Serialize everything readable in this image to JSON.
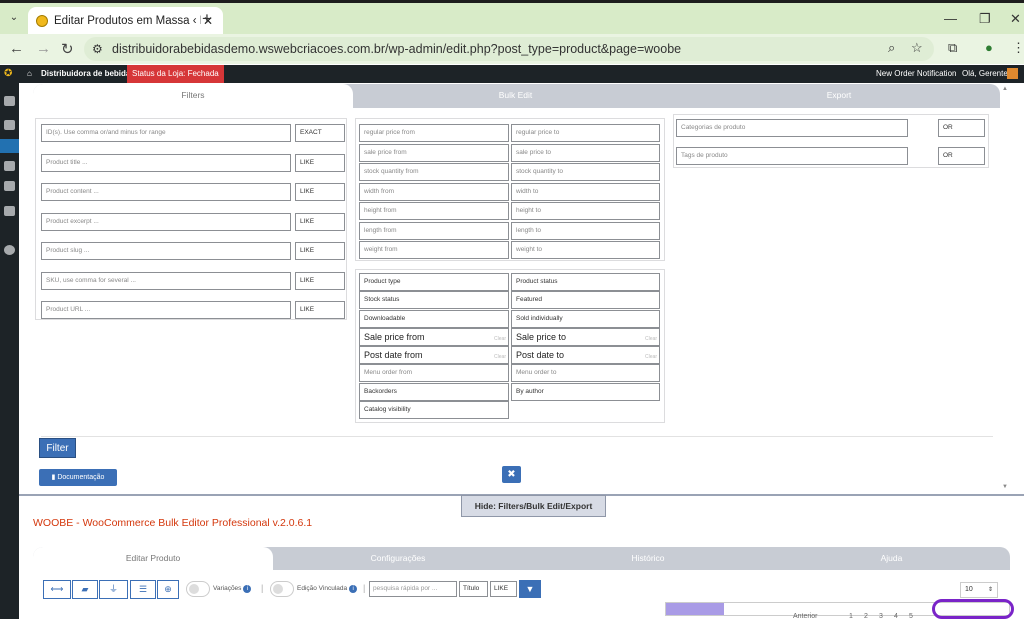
{
  "browser": {
    "tab_title": "Editar Produtos em Massa ‹ Dis",
    "url": "distribuidorabebidasdemo.wswebcriacoes.com.br/wp-admin/edit.php?post_type=product&page=woobe"
  },
  "wpbar": {
    "site": "Distribuidora de bebidas",
    "store_status": "Status da Loja: Fechada",
    "notification": "New Order Notification",
    "greeting": "Olá, Gerente"
  },
  "panel_tabs": [
    "Filters",
    "Bulk Edit",
    "Export"
  ],
  "filters": {
    "col1": [
      {
        "ph": "ID(s). Use comma or/and minus for range",
        "op": "EXACT"
      },
      {
        "ph": "Product title ...",
        "op": "LIKE"
      },
      {
        "ph": "Product content ...",
        "op": "LIKE"
      },
      {
        "ph": "Product excerpt ...",
        "op": "LIKE"
      },
      {
        "ph": "Product slug ...",
        "op": "LIKE"
      },
      {
        "ph": "SKU, use comma for several ...",
        "op": "LIKE"
      },
      {
        "ph": "Product URL ...",
        "op": "LIKE"
      }
    ],
    "ranges": [
      [
        "regular price from",
        "regular price to"
      ],
      [
        "sale price from",
        "sale price to"
      ],
      [
        "stock quantity from",
        "stock quantity to"
      ],
      [
        "width from",
        "width to"
      ],
      [
        "height from",
        "height to"
      ],
      [
        "length from",
        "length to"
      ],
      [
        "weight from",
        "weight to"
      ]
    ],
    "selects": [
      [
        "Product type",
        "Product status"
      ],
      [
        "Stock status",
        "Featured"
      ],
      [
        "Downloadable",
        "Sold individually"
      ]
    ],
    "dates": [
      [
        "Sale price from",
        "Sale price to"
      ],
      [
        "Post date from",
        "Post date to"
      ]
    ],
    "date_clear": "Clear",
    "menu_order": [
      "Menu order from",
      "Menu order to"
    ],
    "misc": [
      [
        "Backorders",
        "By author"
      ]
    ],
    "catalog": "Catalog visibility",
    "tax": [
      {
        "ph": "Categorias de produto",
        "op": "OR"
      },
      {
        "ph": "Tags de produto",
        "op": "OR"
      }
    ],
    "filter_btn": "Filter",
    "doc_btn": "Documentação",
    "close_btn": "✖"
  },
  "hide_btn": "Hide: Filters/Bulk Edit/Export",
  "app_title": "WOOBE - WooCommerce Bulk Editor Professional v.2.0.6.1",
  "bottom_tabs": [
    "Editar Produto",
    "Configurações",
    "Histórico",
    "Ajuda"
  ],
  "toolbar": {
    "variacoes": "Variações",
    "edicao": "Edição Vinculada",
    "search_ph": "pesquisa rápida por ...",
    "field": "Título",
    "op": "LIKE",
    "per_page": "10",
    "sep": "|"
  },
  "pagination": {
    "prev": "Anterior",
    "pages": [
      "1",
      "2",
      "3",
      "4",
      "5"
    ]
  },
  "progress": 0.17,
  "colors": {
    "accent": "#3b6fb6",
    "title": "#d4380d",
    "store": "#d63638"
  }
}
